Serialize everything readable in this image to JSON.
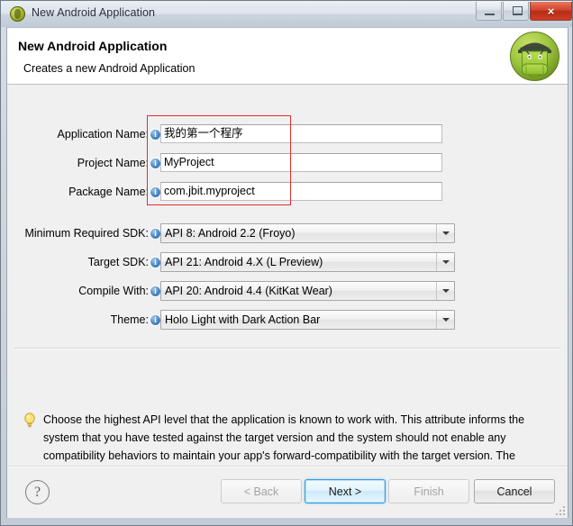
{
  "window": {
    "title": "New Android Application",
    "icon": "android-head-icon",
    "controls": {
      "minimize": "minimize-icon",
      "maximize": "restore-icon",
      "close": "×"
    }
  },
  "header": {
    "title": "New Android Application",
    "subtitle": "Creates a new Android Application",
    "logo": "android-robot-logo"
  },
  "form": {
    "text_fields": [
      {
        "label": "Application Name:",
        "value": "我的第一个程序",
        "info": "info-icon"
      },
      {
        "label": "Project Name:",
        "value": "MyProject",
        "info": "info-icon"
      },
      {
        "label": "Package Name:",
        "value": "com.jbit.myproject",
        "info": "info-icon"
      }
    ],
    "combos": [
      {
        "label": "Minimum Required SDK:",
        "value": "API 8: Android 2.2 (Froyo)",
        "info": "info-icon"
      },
      {
        "label": "Target SDK:",
        "value": "API 21: Android 4.X (L Preview)",
        "info": "info-icon"
      },
      {
        "label": "Compile With:",
        "value": "API 20: Android 4.4 (KitKat Wear)",
        "info": "info-icon"
      },
      {
        "label": "Theme:",
        "value": "Holo Light with Dark Action Bar",
        "info": "info-icon"
      }
    ]
  },
  "help": {
    "icon": "lightbulb-icon",
    "text": "Choose the highest API level that the application is known to work with. This attribute informs the system that you have tested against the target version and the system should not enable any compatibility behaviors to maintain your app's forward-compatibility with the target version. The application is still able to run on older versions (down to minSdkVersion). Your application may"
  },
  "footer": {
    "help_button": "?",
    "buttons": [
      {
        "label": "< Back",
        "state": "disabled"
      },
      {
        "label": "Next >",
        "state": "default"
      },
      {
        "label": "Finish",
        "state": "disabled"
      },
      {
        "label": "Cancel",
        "state": "normal"
      }
    ]
  },
  "annotation": {
    "color": "#e03030",
    "shape": "rectangle-highlight"
  }
}
